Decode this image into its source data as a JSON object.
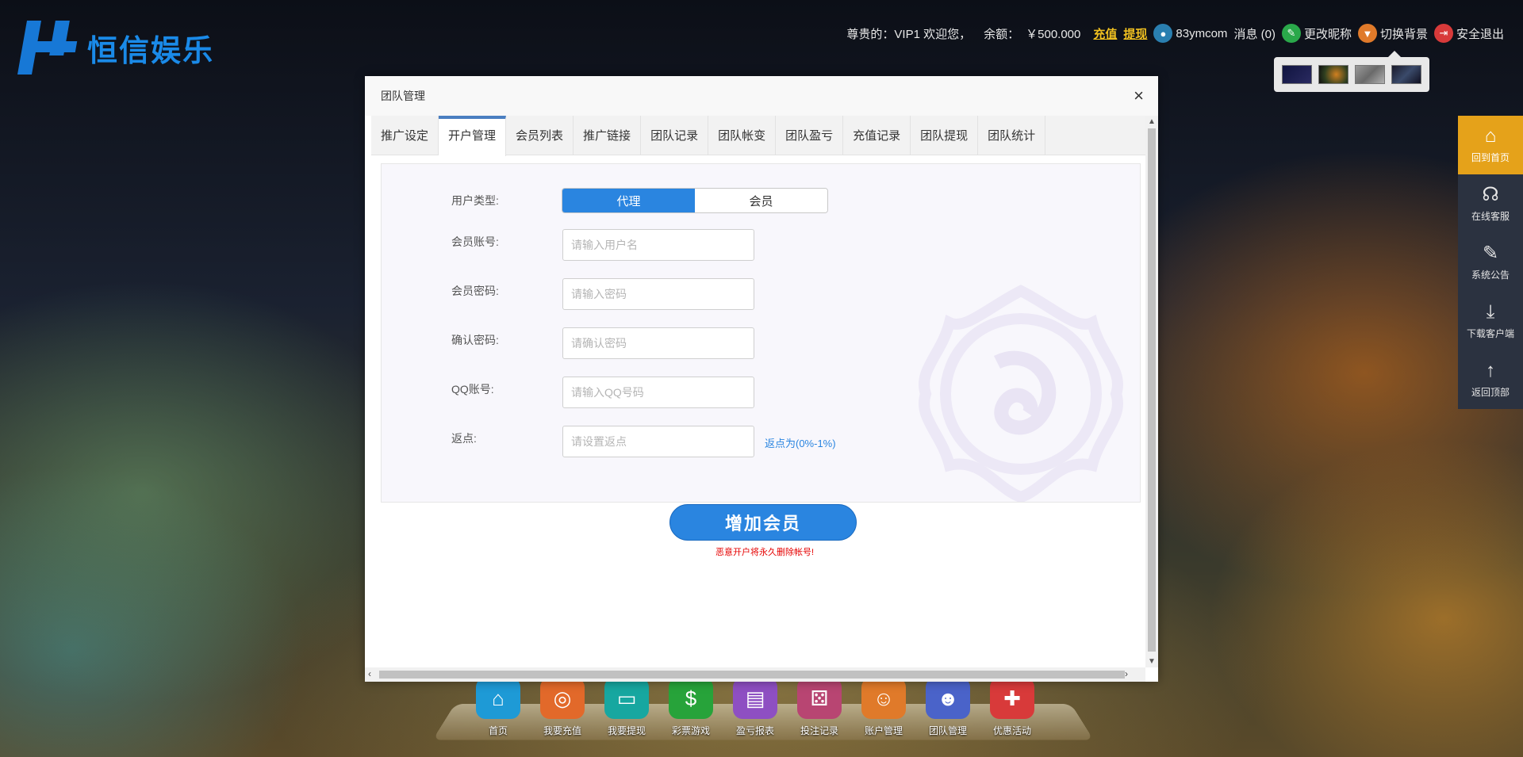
{
  "brand": {
    "name": "恒信娱乐",
    "color": "#1a8ae8"
  },
  "topbar": {
    "greeting": "尊贵的：VIP1 欢迎您，",
    "balance_label": "余额：",
    "balance": "￥500.000",
    "recharge": "充值",
    "withdraw": "提现",
    "username": "83ymcom",
    "messages": "消息 (0)",
    "edit_nick": "更改昵称",
    "switch_bg": "切换背景",
    "logout": "安全退出"
  },
  "sidebar": {
    "items": [
      {
        "label": "回到首页",
        "icon": "home-icon",
        "active": true
      },
      {
        "label": "在线客服",
        "icon": "headset-icon"
      },
      {
        "label": "系统公告",
        "icon": "pencil-icon"
      },
      {
        "label": "下载客户端",
        "icon": "download-icon"
      },
      {
        "label": "返回顶部",
        "icon": "arrow-up-icon"
      }
    ]
  },
  "dock": {
    "items": [
      {
        "label": "首页",
        "color": "#1e9ad6"
      },
      {
        "label": "我要充值",
        "color": "#e2692a"
      },
      {
        "label": "我要提现",
        "color": "#17a7a0"
      },
      {
        "label": "彩票游戏",
        "color": "#27a33a"
      },
      {
        "label": "盈亏报表",
        "color": "#8e4fc2"
      },
      {
        "label": "投注记录",
        "color": "#b84572"
      },
      {
        "label": "账户管理",
        "color": "#e07a2a"
      },
      {
        "label": "团队管理",
        "color": "#4a63c9"
      },
      {
        "label": "优惠活动",
        "color": "#d83a3a"
      }
    ]
  },
  "dialog": {
    "title": "团队管理",
    "close": "×",
    "tabs": [
      "推广设定",
      "开户管理",
      "会员列表",
      "推广链接",
      "团队记录",
      "团队帐变",
      "团队盈亏",
      "充值记录",
      "团队提现",
      "团队统计"
    ],
    "active_tab": "开户管理",
    "form": {
      "user_type_label": "用户类型:",
      "type_agent": "代理",
      "type_member": "会员",
      "account_label": "会员账号:",
      "account_placeholder": "请输入用户名",
      "password_label": "会员密码:",
      "password_placeholder": "请输入密码",
      "confirm_label": "确认密码:",
      "confirm_placeholder": "请确认密码",
      "qq_label": "QQ账号:",
      "qq_placeholder": "请输入QQ号码",
      "rebate_label": "返点:",
      "rebate_placeholder": "请设置返点",
      "rebate_hint": "返点为(0%-1%)"
    },
    "submit": "增加会员",
    "warning": "恶意开户将永久删除帐号!"
  }
}
